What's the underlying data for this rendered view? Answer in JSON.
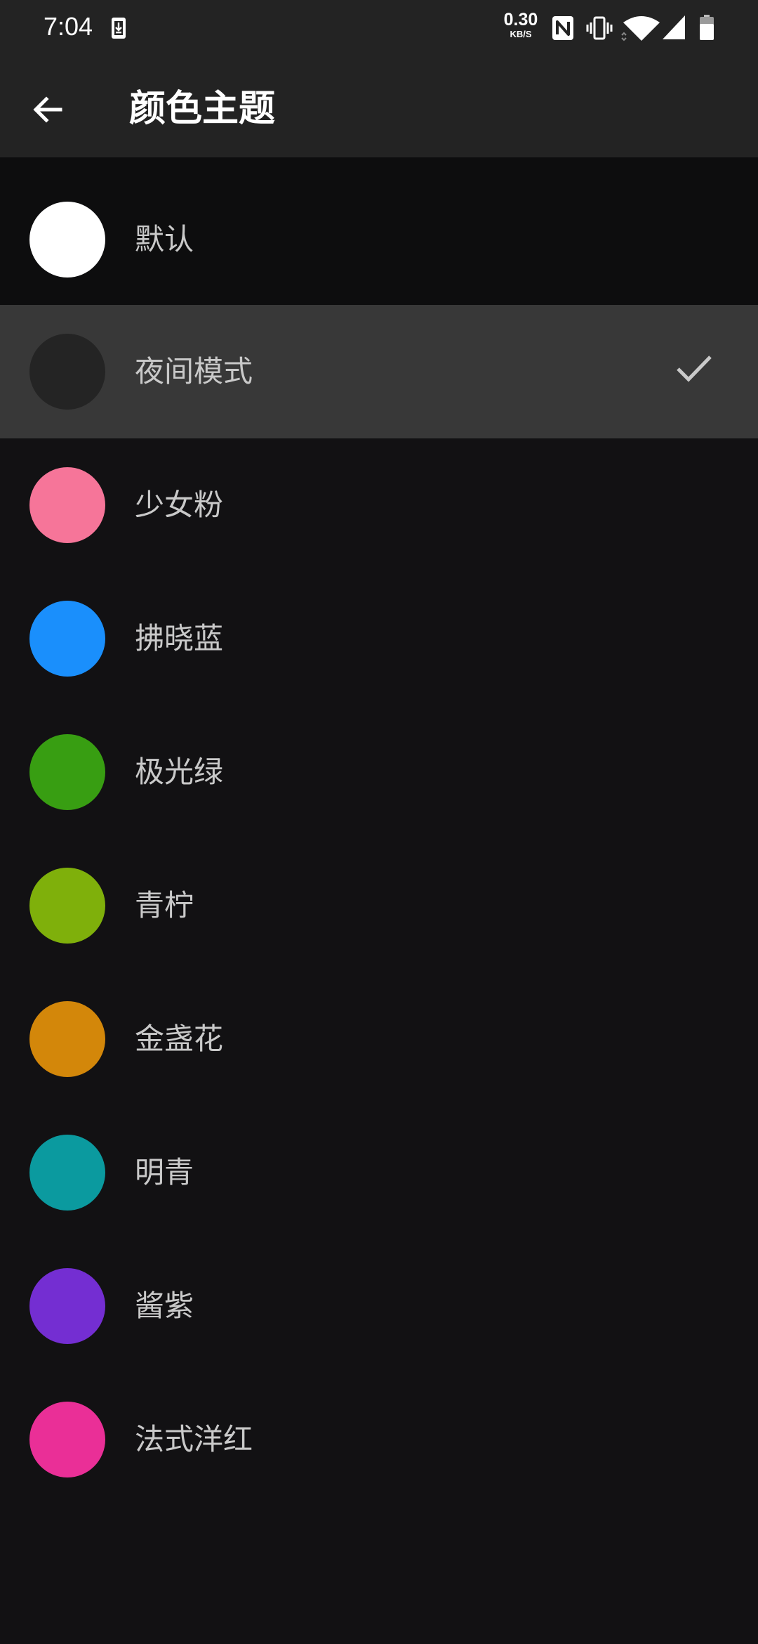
{
  "status_bar": {
    "time": "7:04",
    "net_speed_value": "0.30",
    "net_speed_unit": "KB/S",
    "icons": [
      "download-notification-icon",
      "nfc-icon",
      "vibrate-icon",
      "wifi-icon",
      "cell-signal-icon",
      "battery-icon"
    ]
  },
  "app_bar": {
    "title": "颜色主题",
    "back_icon": "arrow-left-icon"
  },
  "themes": [
    {
      "label": "默认",
      "color": "#ffffff",
      "selected": false
    },
    {
      "label": "夜间模式",
      "color": "#242424",
      "selected": true
    },
    {
      "label": "少女粉",
      "color": "#f67599",
      "selected": false
    },
    {
      "label": "拂晓蓝",
      "color": "#1a8ffc",
      "selected": false
    },
    {
      "label": "极光绿",
      "color": "#389e12",
      "selected": false
    },
    {
      "label": "青柠",
      "color": "#7fb00b",
      "selected": false
    },
    {
      "label": "金盏花",
      "color": "#d3870a",
      "selected": false
    },
    {
      "label": "明青",
      "color": "#0b9a9f",
      "selected": false
    },
    {
      "label": "酱紫",
      "color": "#742ed2",
      "selected": false
    },
    {
      "label": "法式洋红",
      "color": "#ea2f97",
      "selected": false
    }
  ],
  "colors": {
    "bar_background": "#232323",
    "page_background": "#121113",
    "selected_row": "#383838",
    "label_text": "#c9c9c9",
    "check": "#c9c9c9"
  }
}
